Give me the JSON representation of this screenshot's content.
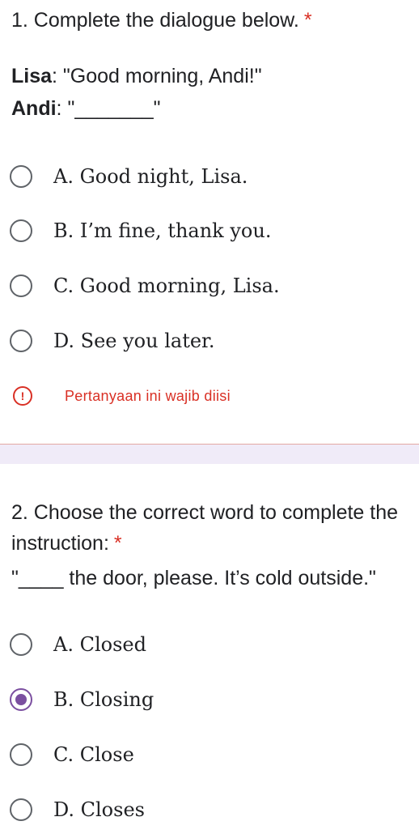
{
  "q1": {
    "title": "1. Complete the dialogue below.",
    "required_mark": "*",
    "lines": [
      {
        "speaker": "Lisa",
        "text": ": \"Good morning, Andi!\""
      },
      {
        "speaker": "Andi",
        "text": ": \"_______\""
      }
    ],
    "options": [
      {
        "label": "A. Good night, Lisa.",
        "selected": false
      },
      {
        "label": "B. I’m fine, thank you.",
        "selected": false
      },
      {
        "label": "C. Good morning, Lisa.",
        "selected": false
      },
      {
        "label": "D. See you later.",
        "selected": false
      }
    ],
    "error": {
      "icon": "error-icon",
      "text": "Pertanyaan ini wajib diisi",
      "color": "#d93025"
    }
  },
  "q2": {
    "title": "2. Choose the correct word to complete the instruction:",
    "required_mark": "*",
    "instruction": "\"____ the door, please. It’s cold outside.\"",
    "options": [
      {
        "label": "A. Closed",
        "selected": false
      },
      {
        "label": "B. Closing",
        "selected": true
      },
      {
        "label": "C. Close",
        "selected": false
      },
      {
        "label": "D. Closes",
        "selected": false
      }
    ]
  },
  "colors": {
    "accent": "#7b4fa0",
    "required": "#d93025",
    "divider_bg": "#f0ebf8"
  }
}
